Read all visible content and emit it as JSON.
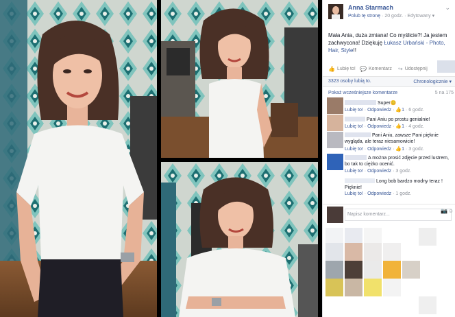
{
  "post": {
    "author": "Anna Starmach",
    "like_page": "Polub tę stronę",
    "time": "20 godz.",
    "edited": "Edytowany",
    "text_intro": "Mała Ania, duża zmiana! Co myślicie?! Ja jestem zachwycona! Dziękuję ",
    "text_link": "Łukasz Urbański - Photo, Hair, Style",
    "text_outro": "!!"
  },
  "actions": {
    "like": "Lubię to!",
    "comment": "Komentarz",
    "share": "Udostępnij"
  },
  "likes": {
    "count": "3323 osoby lubią to.",
    "order": "Chronologicznie"
  },
  "comments_header": {
    "more": "Pokaż wcześniejsze komentarze",
    "count": "5 na 175"
  },
  "comments": [
    {
      "text": "Super😊",
      "like": "Lubię to!",
      "reply": "Odpowiedz",
      "likes": "1",
      "time": "6 godz."
    },
    {
      "text": "Pani Aniu po prostu genialnie!",
      "like": "Lubię to!",
      "reply": "Odpowiedz",
      "likes": "1",
      "time": "4 godz."
    },
    {
      "text": "Pani Aniu, zawsze Pani pięknie wygląda, ale teraz niesamowicie!",
      "like": "Lubię to!",
      "reply": "Odpowiedz",
      "likes": "1",
      "time": "3 godz."
    },
    {
      "text": "A można prosić zdjęcie przed lustrem, bo tak to ciężko ocenić.",
      "like": "Lubię to!",
      "reply": "Odpowiedz",
      "time": "3 godz."
    },
    {
      "text": "Long bob bardzo modny teraz ! Pięknie!",
      "like": "Lubię to!",
      "reply": "Odpowiedz",
      "time": "1 godz."
    }
  ],
  "composer": {
    "placeholder": "Napisz komentarz..."
  },
  "icons": {
    "like": "thumbs-up-icon",
    "comment": "comment-icon",
    "share": "share-icon",
    "camera": "camera-icon",
    "emoji": "emoji-icon",
    "menu": "chevron-down-icon"
  },
  "colors": {
    "link": "#3b5998",
    "text": "#141823",
    "muted": "#90949c",
    "like_blue": "#5890ff"
  }
}
